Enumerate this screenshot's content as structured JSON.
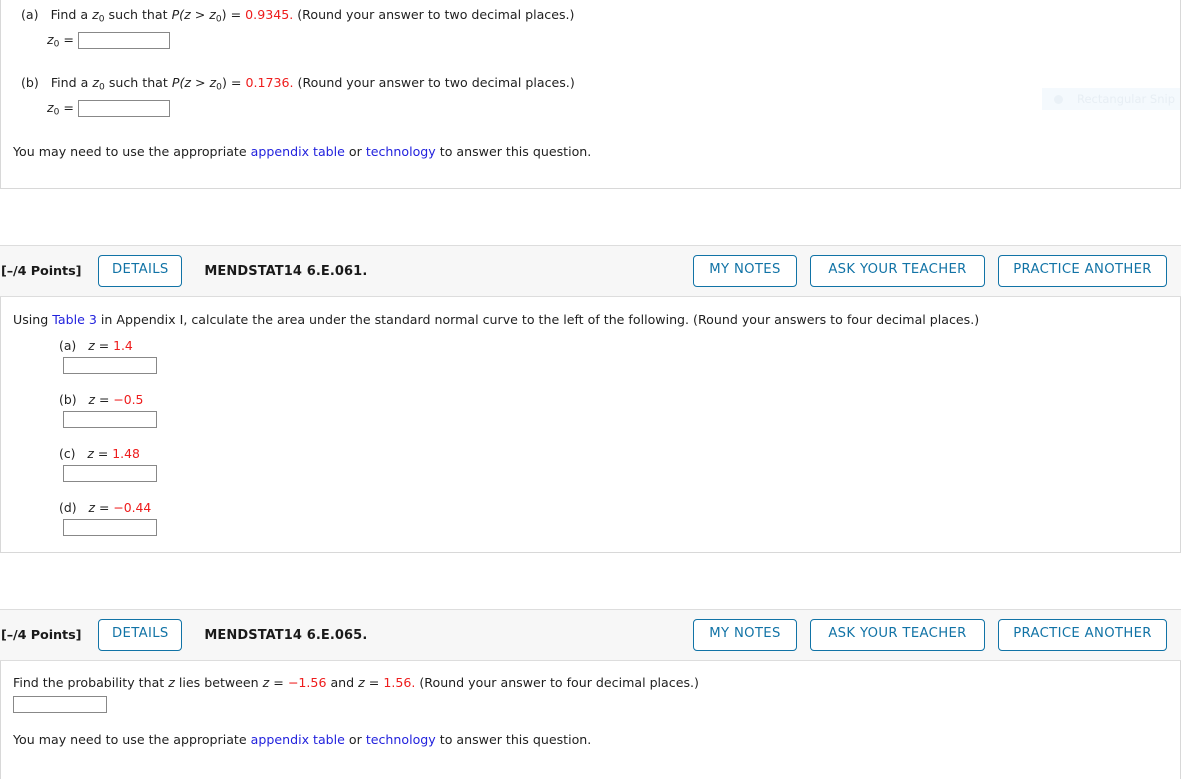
{
  "sections": [
    {
      "id": "section-1",
      "parts": [
        {
          "label": "(a)",
          "text_before": "Find a",
          "zsub": "z",
          "zsub_index": "0",
          "text_mid": "such that",
          "prob": "P(z > z",
          "prob_sub": "0",
          "prob_end": ")",
          "equals": "=",
          "value": "0.9345.",
          "rounding": "(Round your answer to two decimal places.)",
          "answer_label_z": "z",
          "answer_label_sub": "0",
          "answer_label_eq": "=",
          "answer_value": ""
        },
        {
          "label": "(b)",
          "text_before": "Find a",
          "zsub": "z",
          "zsub_index": "0",
          "text_mid": "such that",
          "prob": "P(z > z",
          "prob_sub": "0",
          "prob_end": ")",
          "equals": "=",
          "value": "0.1736.",
          "rounding": "(Round your answer to two decimal places.)",
          "answer_label_z": "z",
          "answer_label_sub": "0",
          "answer_label_eq": "=",
          "answer_value": ""
        }
      ],
      "footnote": {
        "before": "You may need to use the appropriate ",
        "link1": "appendix table",
        "middle": " or ",
        "link2": "technology",
        "after": " to answer this question."
      }
    },
    {
      "id": "section-2",
      "header": {
        "points": "[–/4 Points]",
        "details_label": "DETAILS",
        "question_id": "MENDSTAT14 6.E.061.",
        "my_notes_label": "MY NOTES",
        "ask_teacher_label": "ASK YOUR TEACHER",
        "practice_another_label": "PRACTICE ANOTHER"
      },
      "intro": {
        "before": "Using ",
        "link": "Table 3",
        "after": " in Appendix I, calculate the area under the standard normal curve to the left of the following. (Round your answers to four decimal places.)"
      },
      "items": [
        {
          "label": "(a)",
          "var": "z",
          "eq": "=",
          "value": "1.4",
          "answer_value": ""
        },
        {
          "label": "(b)",
          "var": "z",
          "eq": "=",
          "value": "−0.5",
          "answer_value": ""
        },
        {
          "label": "(c)",
          "var": "z",
          "eq": "=",
          "value": "1.48",
          "answer_value": ""
        },
        {
          "label": "(d)",
          "var": "z",
          "eq": "=",
          "value": "−0.44",
          "answer_value": ""
        }
      ]
    },
    {
      "id": "section-3",
      "header": {
        "points": "[–/4 Points]",
        "details_label": "DETAILS",
        "question_id": "MENDSTAT14 6.E.065.",
        "my_notes_label": "MY NOTES",
        "ask_teacher_label": "ASK YOUR TEACHER",
        "practice_another_label": "PRACTICE ANOTHER"
      },
      "prompt": {
        "p1": "Find the probability that ",
        "var1": "z",
        "p2": " lies between ",
        "var2": "z",
        "eq1": " = ",
        "val1": "−1.56",
        "p3": " and ",
        "var3": "z",
        "eq2": " = ",
        "val2": "1.56.",
        "p4": " (Round your answer to four decimal places.)"
      },
      "answer_value": "",
      "footnote": {
        "before": "You may need to use the appropriate ",
        "link1": "appendix table",
        "middle": " or ",
        "link2": "technology",
        "after": " to answer this question."
      }
    }
  ],
  "overlay": {
    "snip_label": "Rectangular Snip"
  },
  "colors": {
    "accent_blue": "#1173a6",
    "link_blue": "#2222dd",
    "value_red": "#ee1c1c",
    "header_bg": "#f7f7f7",
    "border": "#d8d8d8"
  }
}
